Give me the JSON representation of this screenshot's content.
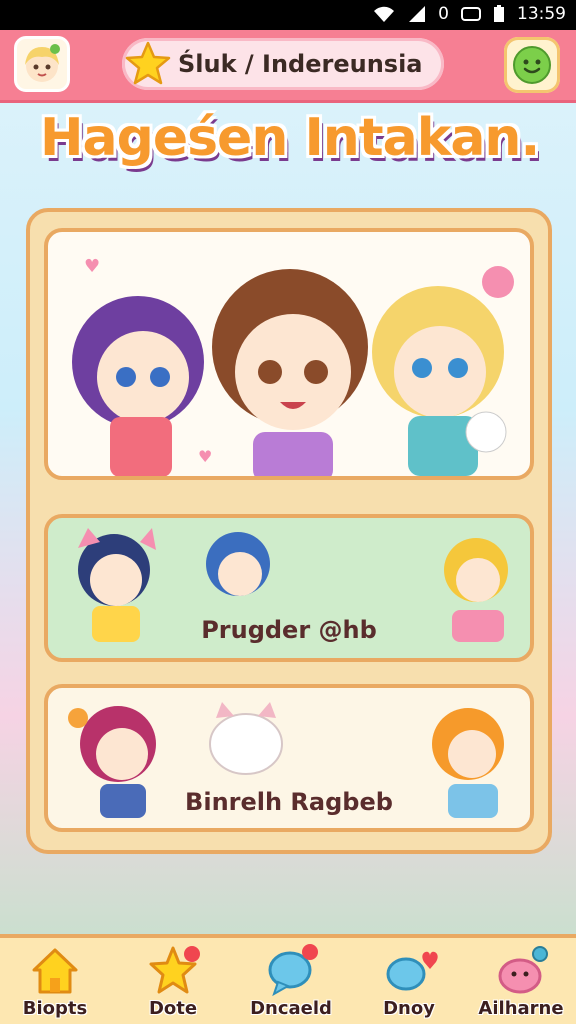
{
  "status_bar": {
    "signal_text": "0",
    "time": "13:59"
  },
  "header": {
    "search_text": "Śluk / Indereunsia"
  },
  "title": "Hageśen Intakan.",
  "cards": [
    {
      "label": "Prugder @hb"
    },
    {
      "label": "Binrelh Ragbeb"
    }
  ],
  "nav": [
    {
      "label": "Biopts",
      "icon": "house-icon"
    },
    {
      "label": "Dote",
      "icon": "star-icon"
    },
    {
      "label": "Dncaeld",
      "icon": "chat-bubble-icon"
    },
    {
      "label": "Dnoy",
      "icon": "heart-chat-icon"
    },
    {
      "label": "Ailharne",
      "icon": "pink-pet-icon"
    }
  ],
  "colors": {
    "header": "#f67f93",
    "frame": "#f7dfae",
    "accent": "#e9a962",
    "card_green": "#cfeccb"
  }
}
